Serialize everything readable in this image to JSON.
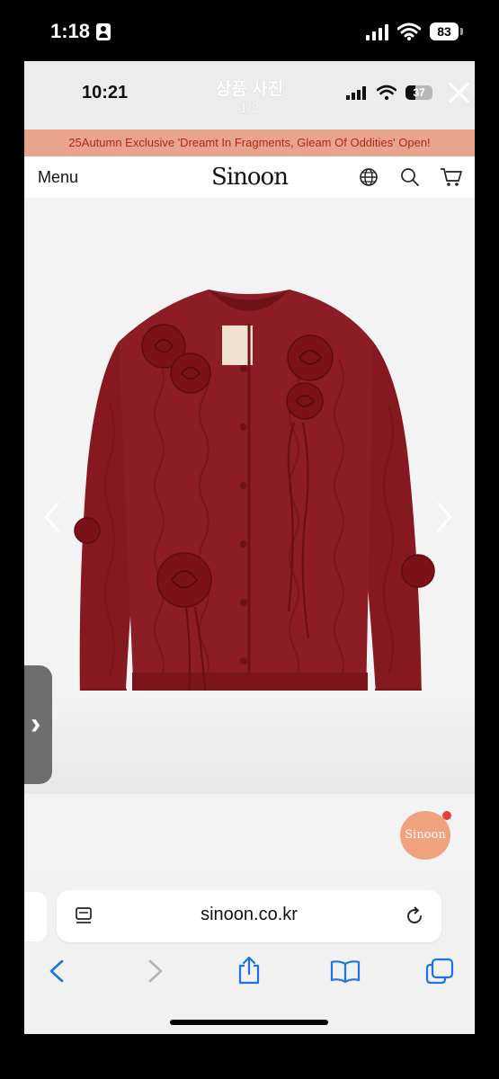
{
  "device": {
    "time": "1:18",
    "battery": "83"
  },
  "inner_status": {
    "time": "10:21",
    "battery": "37"
  },
  "viewer": {
    "title": "상품 사진",
    "counter": "1/2"
  },
  "banner": {
    "text": "25Autumn Exclusive 'Dreamt In Fragments, Gleam Of Oddities' Open!"
  },
  "site_nav": {
    "menu_label": "Menu",
    "logo_text": "Sinoon",
    "icons": [
      "globe-icon",
      "search-icon",
      "cart-icon"
    ]
  },
  "product": {
    "description": "red cable-knit cardigan with rose appliqués and ribbon ties",
    "colors": {
      "knit": "#8c1d24",
      "knit_dark": "#6e1218",
      "rose": "#7a1218"
    }
  },
  "chat_widget": {
    "label": "Sinoon"
  },
  "browser": {
    "url": "sinoon.co.kr",
    "toolbar_icons": [
      "back-icon",
      "forward-icon",
      "share-icon",
      "bookmarks-icon",
      "tabs-icon"
    ]
  },
  "colors": {
    "banner_bg": "#e9a48c",
    "banner_text": "#b3261b",
    "accent_blue": "#1a73e8",
    "chat_bubble": "#f0a27e"
  }
}
